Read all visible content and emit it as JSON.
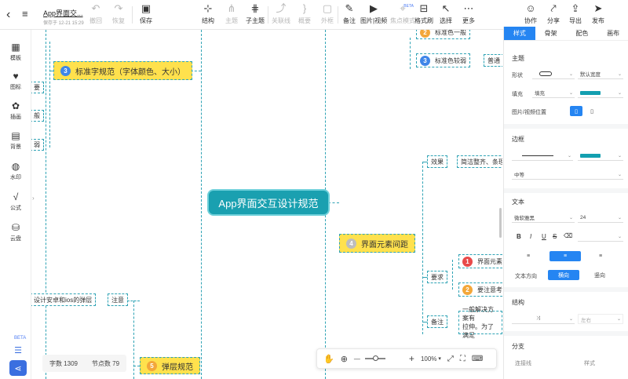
{
  "header": {
    "back_icon": "chevron-left-icon",
    "menu_icon": "hamburger-icon",
    "doc_title": "App界面交...",
    "save_status": "保存于 12-21 15:29",
    "undo": "撤回",
    "redo": "恢复",
    "save": "保存",
    "toolbar": [
      "结构",
      "主题",
      "子主题",
      "关联线",
      "概要",
      "外框",
      "备注",
      "图片|视频",
      "焦点模式",
      "格式刷",
      "选择",
      "更多"
    ],
    "beta_tag": "BETA",
    "right_actions": [
      "协作",
      "分享",
      "导出",
      "发布"
    ]
  },
  "sidebar": {
    "items": [
      "模板",
      "图标",
      "插画",
      "背景",
      "水印",
      "公式",
      "云盘"
    ],
    "beta_tag": "BETA"
  },
  "canvas": {
    "root": "App界面交互设计规范",
    "branches": [
      {
        "num": "3",
        "label": "标准字规范（字体颜色、大小）"
      },
      {
        "num": "4",
        "label": "界面元素间距"
      },
      {
        "num": "5",
        "label": "弹层规范"
      }
    ],
    "left_fragments": [
      "要",
      "般",
      "弱"
    ],
    "top_right_nodes": [
      {
        "num": "2",
        "label": "标准色一般"
      },
      {
        "num": "3",
        "label": "标准色较弱"
      },
      {
        "num": "",
        "label": "普通"
      }
    ],
    "spacing_children": {
      "effect": "效果",
      "effect_value": "简洁整齐、条理",
      "require": "要求",
      "require_items": [
        {
          "num": "1",
          "label": "界面元素"
        },
        {
          "num": "2",
          "label": "要注意考"
        }
      ],
      "note": "备注",
      "note_value": "一般解决方案有\n拉伸。为了满足"
    },
    "popup_children": {
      "note": "注意",
      "note_value": "设计安卓和ios的弹层"
    },
    "stats": {
      "words": "字数 1309",
      "nodes": "节点数 79"
    },
    "zoom": "100%"
  },
  "panel": {
    "tabs": [
      "样式",
      "骨架",
      "配色",
      "画布"
    ],
    "theme_title": "主题",
    "shape_label": "形状",
    "width_value": "默认宽度",
    "fill_label": "填充",
    "fill_value": "填充",
    "media_pos_label": "图片/视频位置",
    "border_title": "边框",
    "border_weight": "中等",
    "text_title": "文本",
    "font_family": "微软雅黑",
    "font_size": "24",
    "text_dir_label": "文本方向",
    "dir_h": "横向",
    "dir_v": "竖向",
    "struct_title": "结构",
    "struct_pos": "左右",
    "branch_title": "分支",
    "conn_label": "连接线",
    "style_label": "样式",
    "accent_color": "#139fb0",
    "tab_active_color": "#2585f2"
  }
}
